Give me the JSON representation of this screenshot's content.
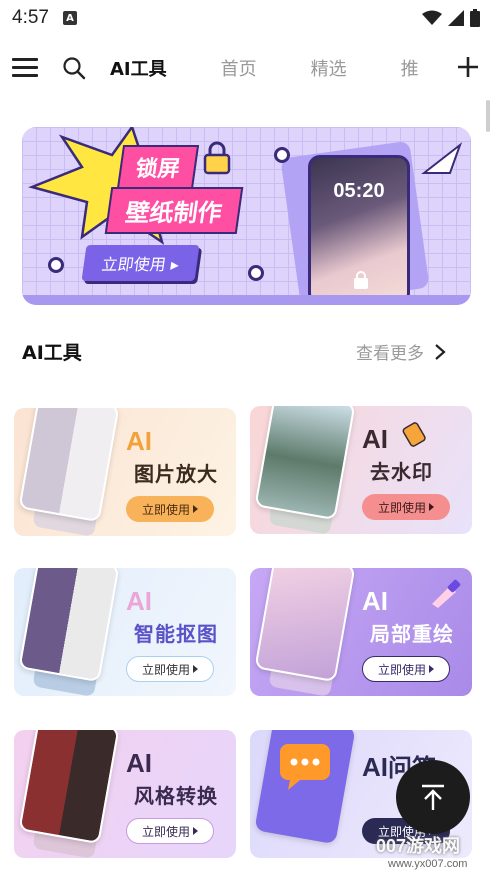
{
  "status_bar": {
    "time": "4:57",
    "app_badge": "A"
  },
  "nav": {
    "tabs": [
      "AI工具",
      "首页",
      "精选",
      "推"
    ],
    "active_tab": 0,
    "icons": [
      "menu-icon",
      "search-icon",
      "plus-icon"
    ]
  },
  "banner": {
    "title_line1": "锁屏",
    "title_line2": "壁纸制作",
    "cta": "立即使用",
    "clock": "05:20"
  },
  "section": {
    "title": "AI工具",
    "more": "查看更多"
  },
  "tools": [
    {
      "ai": "AI",
      "name": "图片放大",
      "cta": "立即使用",
      "bg": "#fbe7d6",
      "accent": "#f2a23a",
      "text": "#3a2a20"
    },
    {
      "ai": "AI",
      "name": "去水印",
      "cta": "立即使用",
      "bg": "#fbdcdc",
      "accent": "#f07a7a",
      "text": "#3a2a30"
    },
    {
      "ai": "AI",
      "name": "智能抠图",
      "cta": "立即使用",
      "bg": "#e5f0fb",
      "accent": "#b6d6f5",
      "text": "#5a52c8"
    },
    {
      "ai": "AI",
      "name": "局部重绘",
      "cta": "立即使用",
      "bg": "#b79af0",
      "accent": "#ffffff",
      "text": "#ffffff"
    },
    {
      "ai": "AI",
      "name": "风格转换",
      "cta": "立即使用",
      "bg": "#f6d2ee",
      "accent": "#ffffff",
      "text": "#3a2a50"
    },
    {
      "ai": "AI",
      "name": "问答",
      "cta": "立即使用",
      "bg": "#e4e2fb",
      "accent": "#2a2a55",
      "text": "#2a2a55"
    }
  ],
  "watermark": {
    "brand": "007游戏网",
    "url": "www.yx007.com"
  },
  "colors": {
    "accent_purple": "#7b63e8",
    "pink": "#ff4fa3",
    "fab": "#1c1c1c"
  }
}
